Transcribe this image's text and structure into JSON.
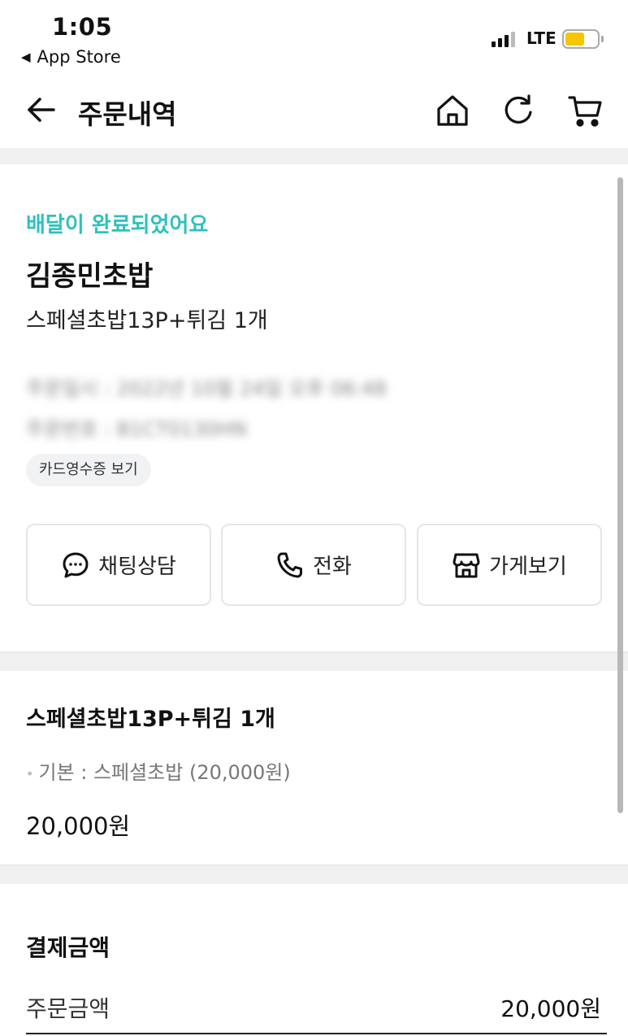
{
  "status_bar": {
    "time": "1:05",
    "back_app": "App Store",
    "network": "LTE",
    "battery_color": "#f7c600"
  },
  "nav": {
    "title": "주문내역",
    "icons": [
      "back-arrow-icon",
      "home-icon",
      "refresh-icon",
      "cart-icon"
    ]
  },
  "order": {
    "status": "배달이 완료되었어요",
    "status_color": "#2ec1bc",
    "store_name": "김종민초밥",
    "summary": "스페셜초밥13P+튀김 1개",
    "order_datetime": "주문일시 : 2022년 10월 24일 오후 06:48",
    "order_number": "주문번호 : B1CT0130HN",
    "receipt_chip": "카드영수증 보기",
    "actions": [
      {
        "label": "채팅상담",
        "icon": "chat-icon"
      },
      {
        "label": "전화",
        "icon": "phone-icon"
      },
      {
        "label": "가게보기",
        "icon": "store-icon"
      }
    ]
  },
  "menu": {
    "title": "스페셜초밥13P+튀김 1개",
    "option": "기본 : 스페셜초밥 (20,000원)",
    "price": "20,000원"
  },
  "payment": {
    "title": "결제금액",
    "order_amount_label": "주문금액",
    "order_amount_value": "20,000원"
  }
}
